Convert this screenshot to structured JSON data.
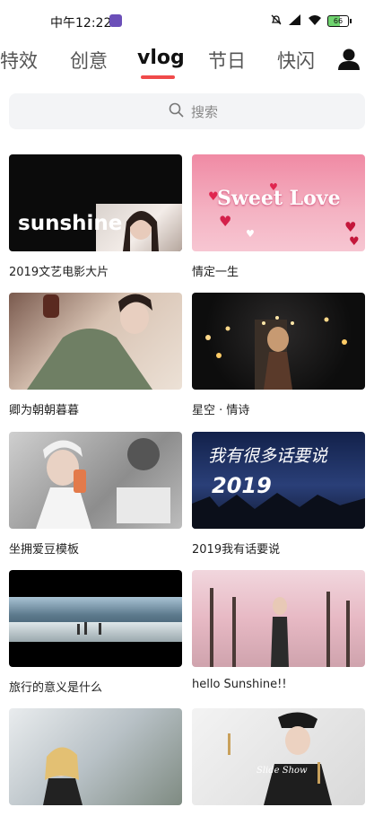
{
  "status": {
    "time": "中午12:22",
    "battery": "66"
  },
  "tabs": [
    "特效",
    "创意",
    "vlog",
    "节日",
    "快闪"
  ],
  "search": {
    "placeholder": "搜索"
  },
  "cards": [
    {
      "title": "2019文艺电影大片",
      "overlay": "sunshine"
    },
    {
      "title": "情定一生",
      "overlay": "Sweet Love"
    },
    {
      "title": "卿为朝朝暮暮",
      "overlay": ""
    },
    {
      "title": "星空 · 情诗",
      "overlay": ""
    },
    {
      "title": "坐拥爱豆模板",
      "overlay": ""
    },
    {
      "title": "2019我有话要说",
      "overlay": "我有很多话要说"
    },
    {
      "title": "旅行的意义是什么",
      "overlay": ""
    },
    {
      "title": "hello Sunshine!!",
      "overlay": ""
    },
    {
      "title": "",
      "overlay": ""
    },
    {
      "title": "",
      "overlay": "Slide Show"
    }
  ]
}
